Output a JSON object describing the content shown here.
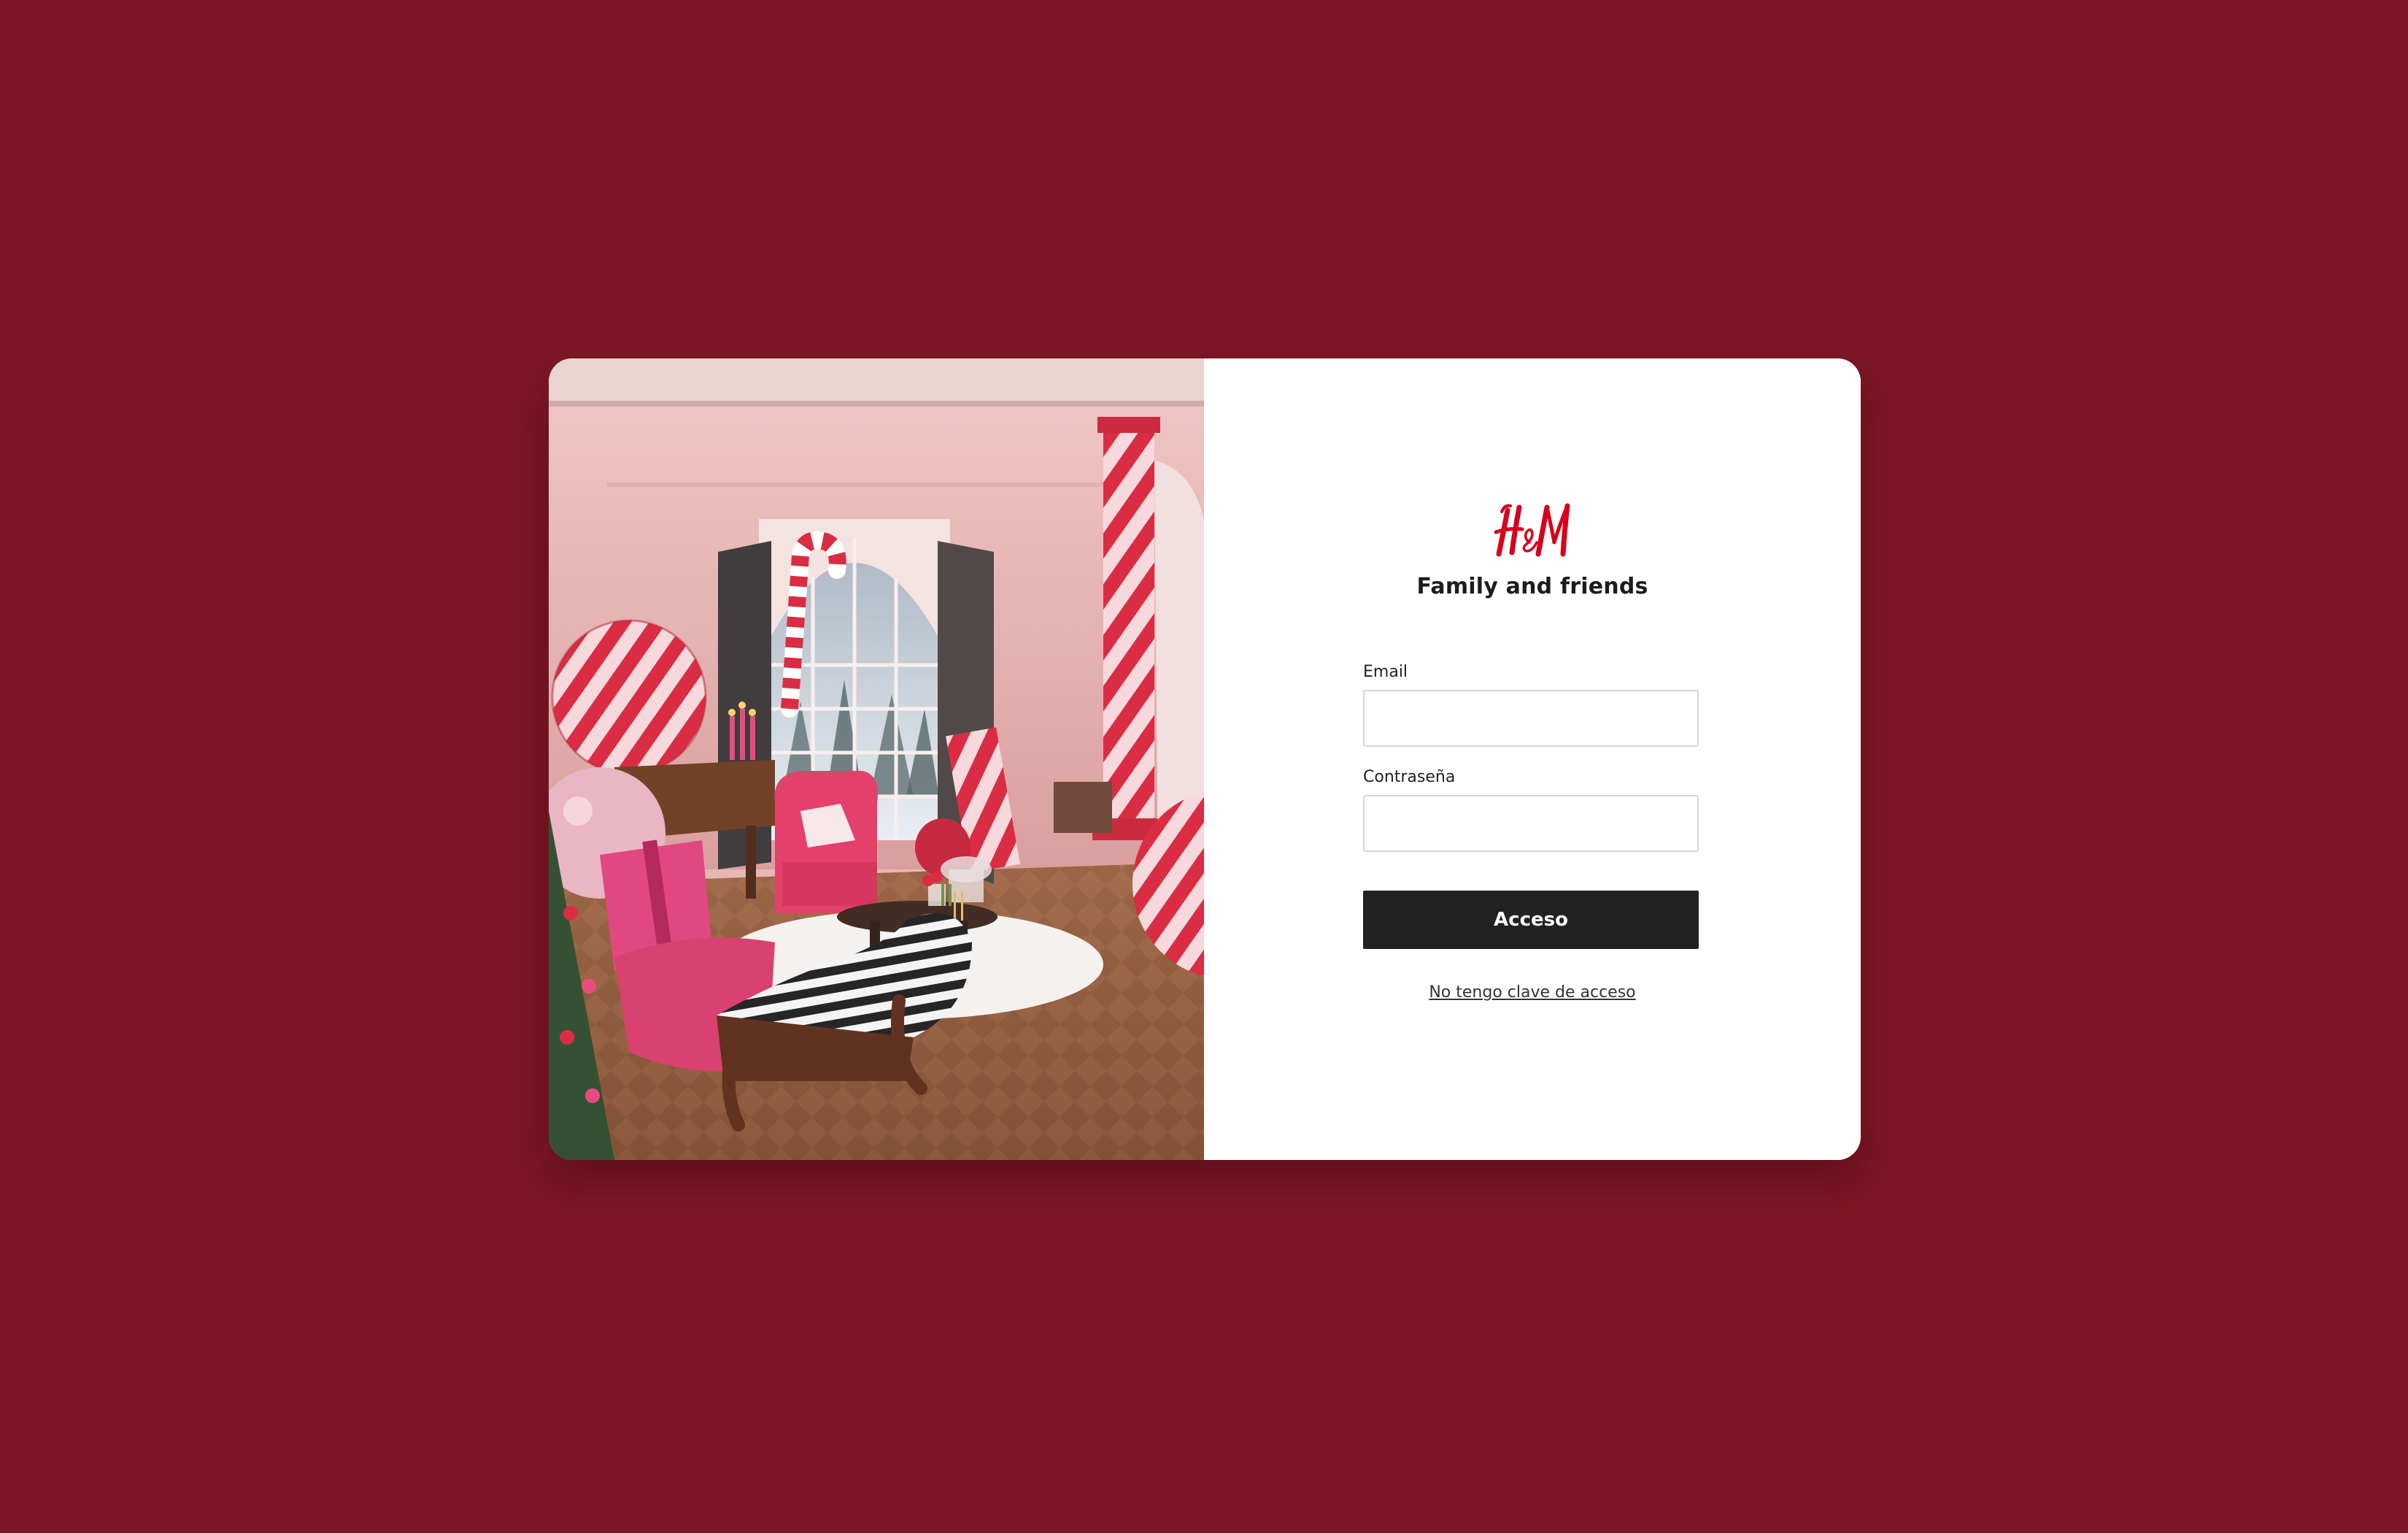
{
  "hero": {
    "scene_description": "",
    "colors": {
      "wall": "#e7b6b4",
      "floor": "#9a6140",
      "accent_red": "#d5273f",
      "pink": "#e8457a"
    }
  },
  "brand": {
    "logo_text": "H&M",
    "logo_color": "#d6001c",
    "title": "Family and friends"
  },
  "form": {
    "email_label": "Email",
    "email_value": "",
    "password_label": "Contraseña",
    "password_value": "",
    "submit_label": "Acceso",
    "no_key_link": "No tengo clave de acceso"
  },
  "theme": {
    "background": "#7e1725",
    "card": "#ffffff",
    "button": "#222222"
  }
}
